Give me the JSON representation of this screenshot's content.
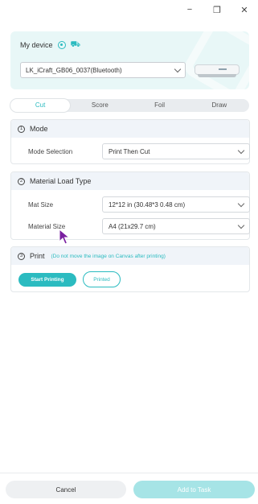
{
  "titlebar": {
    "minimize": "−",
    "restore": "❐",
    "close": "✕"
  },
  "device": {
    "title": "My device",
    "selected": "LK_iCraft_GB06_0037(Bluetooth)",
    "accent": "#2bbbc0"
  },
  "tabs": [
    {
      "label": "Cut",
      "active": true
    },
    {
      "label": "Score",
      "active": false
    },
    {
      "label": "Foil",
      "active": false
    },
    {
      "label": "Draw",
      "active": false
    }
  ],
  "mode": {
    "number": "1",
    "title": "Mode",
    "field_label": "Mode Selection",
    "value": "Print Then Cut"
  },
  "material": {
    "number": "2",
    "title": "Material Load Type",
    "mat_label": "Mat Size",
    "mat_value": "12*12 in (30.48*3 0.48 cm)",
    "size_label": "Material Size",
    "size_value": "A4 (21x29.7 cm)"
  },
  "print": {
    "number": "3",
    "title": "Print",
    "note": "(Do not move the image on Canvas after printing)",
    "start_label": "Start Printing",
    "printed_label": "Printed"
  },
  "footer": {
    "cancel_label": "Cancel",
    "add_label": "Add to Task"
  }
}
